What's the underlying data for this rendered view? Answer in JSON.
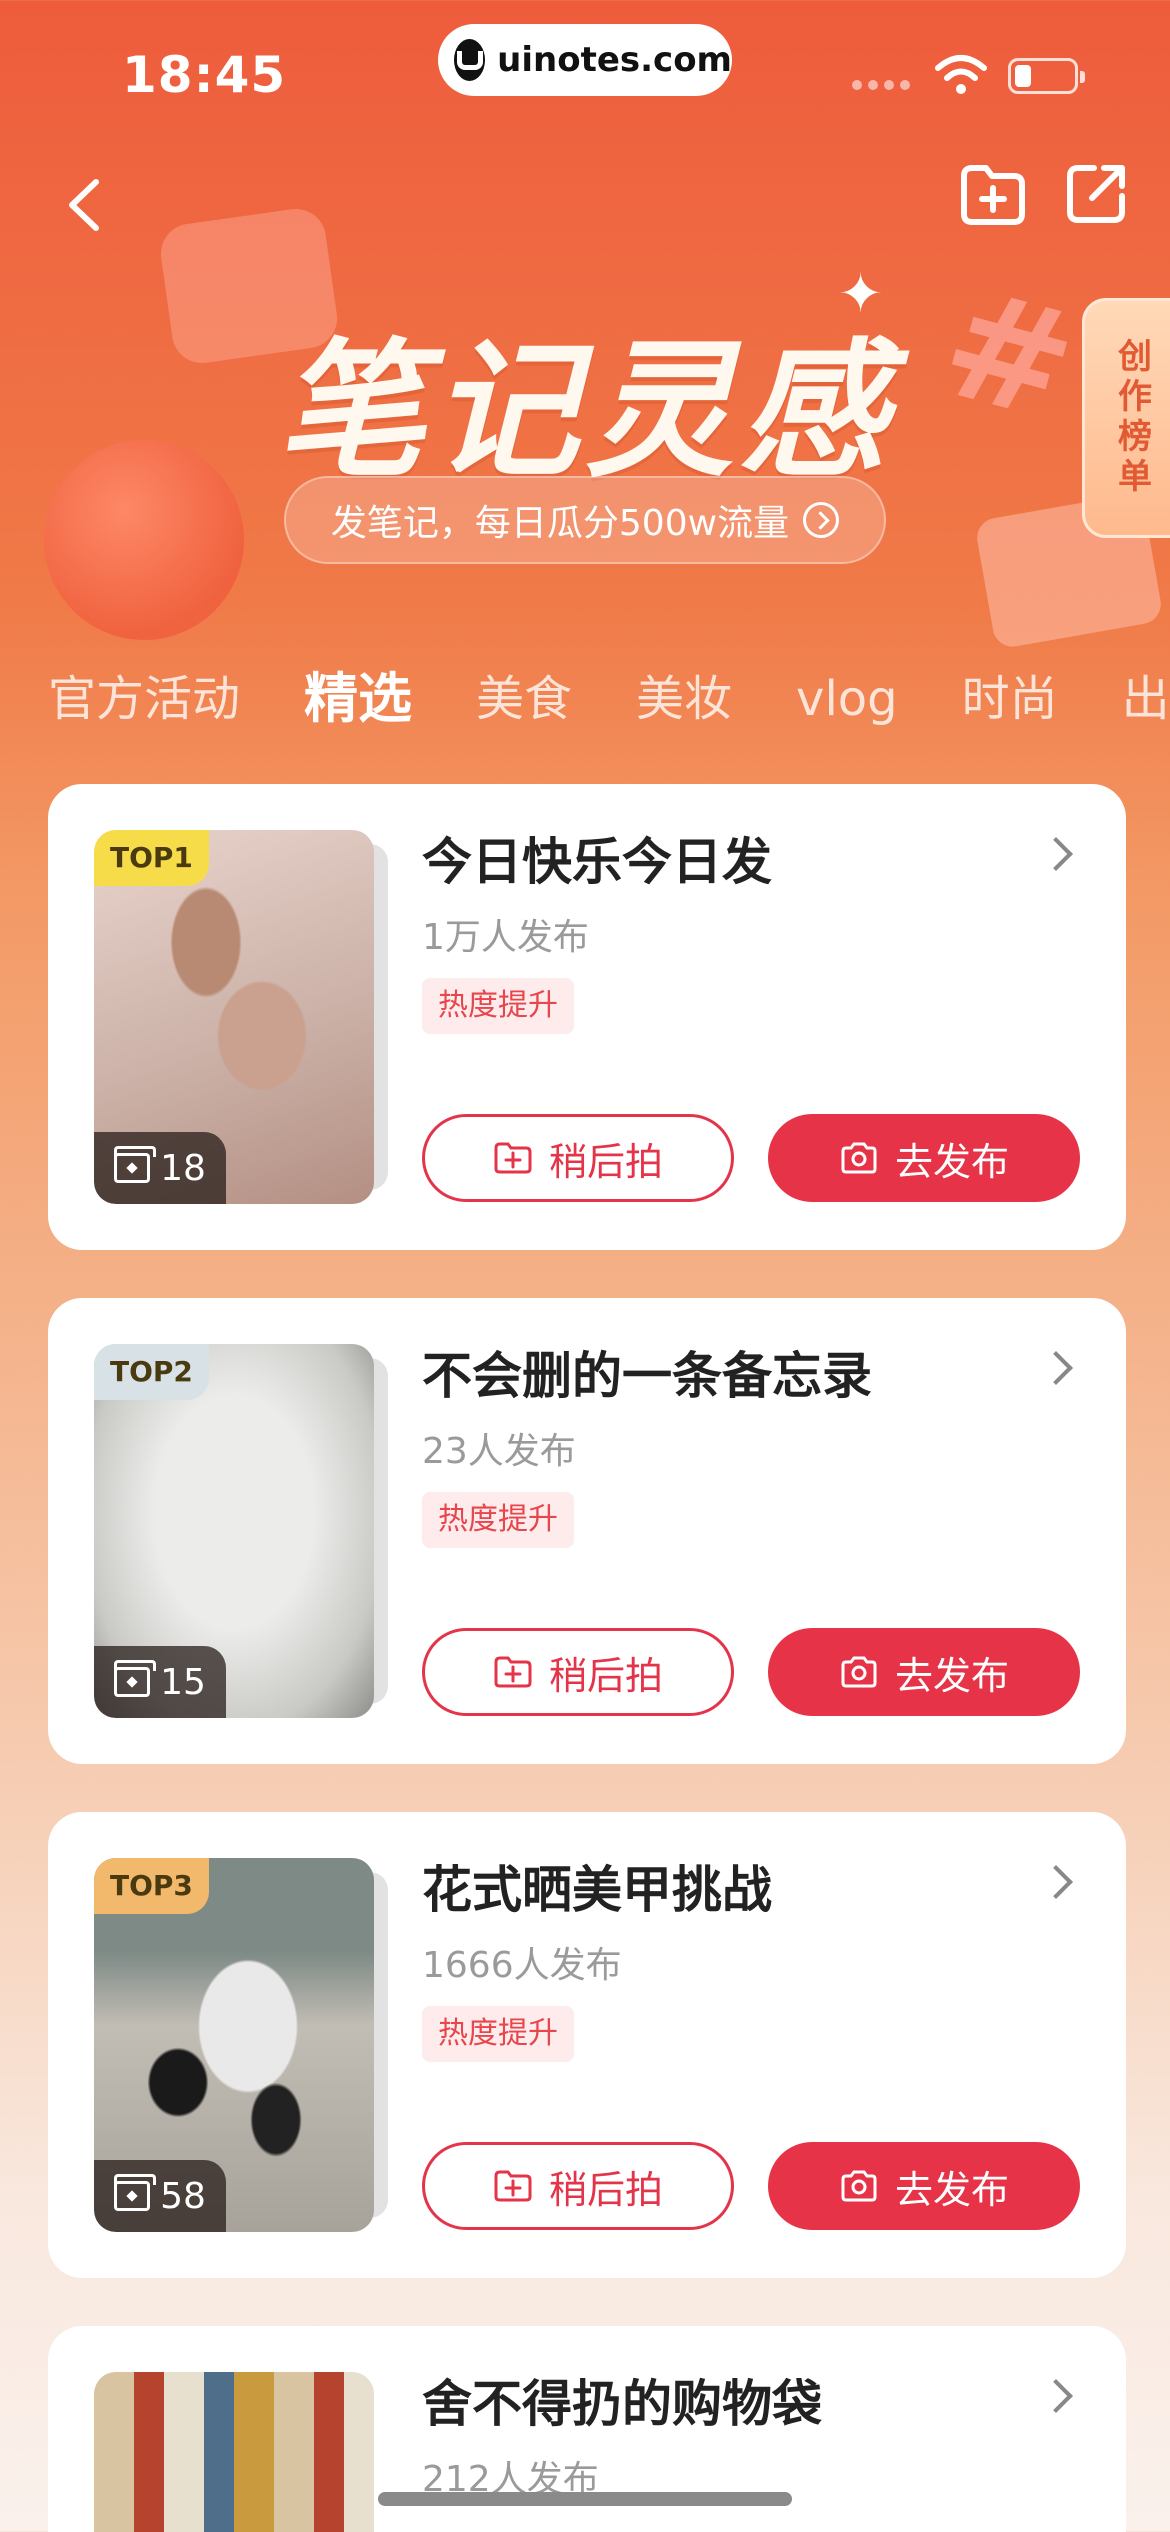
{
  "status_bar": {
    "time": "18:45",
    "url": "uinotes.com"
  },
  "hero": {
    "title": "笔记灵感",
    "subtitle": "发笔记，每日瓜分500w流量",
    "rank_tab": "创作榜单"
  },
  "tabs": [
    "官方活动",
    "精选",
    "美食",
    "美妆",
    "vlog",
    "时尚",
    "出"
  ],
  "active_tab": "精选",
  "colors": {
    "primary": "#e63347",
    "heat_tag_bg": "#fdeceb",
    "top1": "#f7dc4a",
    "top2": "#d8e2e6",
    "top3": "#f2b86c"
  },
  "cards": [
    {
      "rank": "TOP1",
      "title": "今日快乐今日发",
      "count": "1万人发布",
      "tag": "热度提升",
      "saves": "18",
      "later": "稍后拍",
      "post": "去发布"
    },
    {
      "rank": "TOP2",
      "title": "不会删的一条备忘录",
      "count": "23人发布",
      "tag": "热度提升",
      "saves": "15",
      "later": "稍后拍",
      "post": "去发布"
    },
    {
      "rank": "TOP3",
      "title": "花式晒美甲挑战",
      "count": "1666人发布",
      "tag": "热度提升",
      "saves": "58",
      "later": "稍后拍",
      "post": "去发布"
    },
    {
      "title": "舍不得扔的购物袋",
      "count": "212人发布"
    }
  ]
}
